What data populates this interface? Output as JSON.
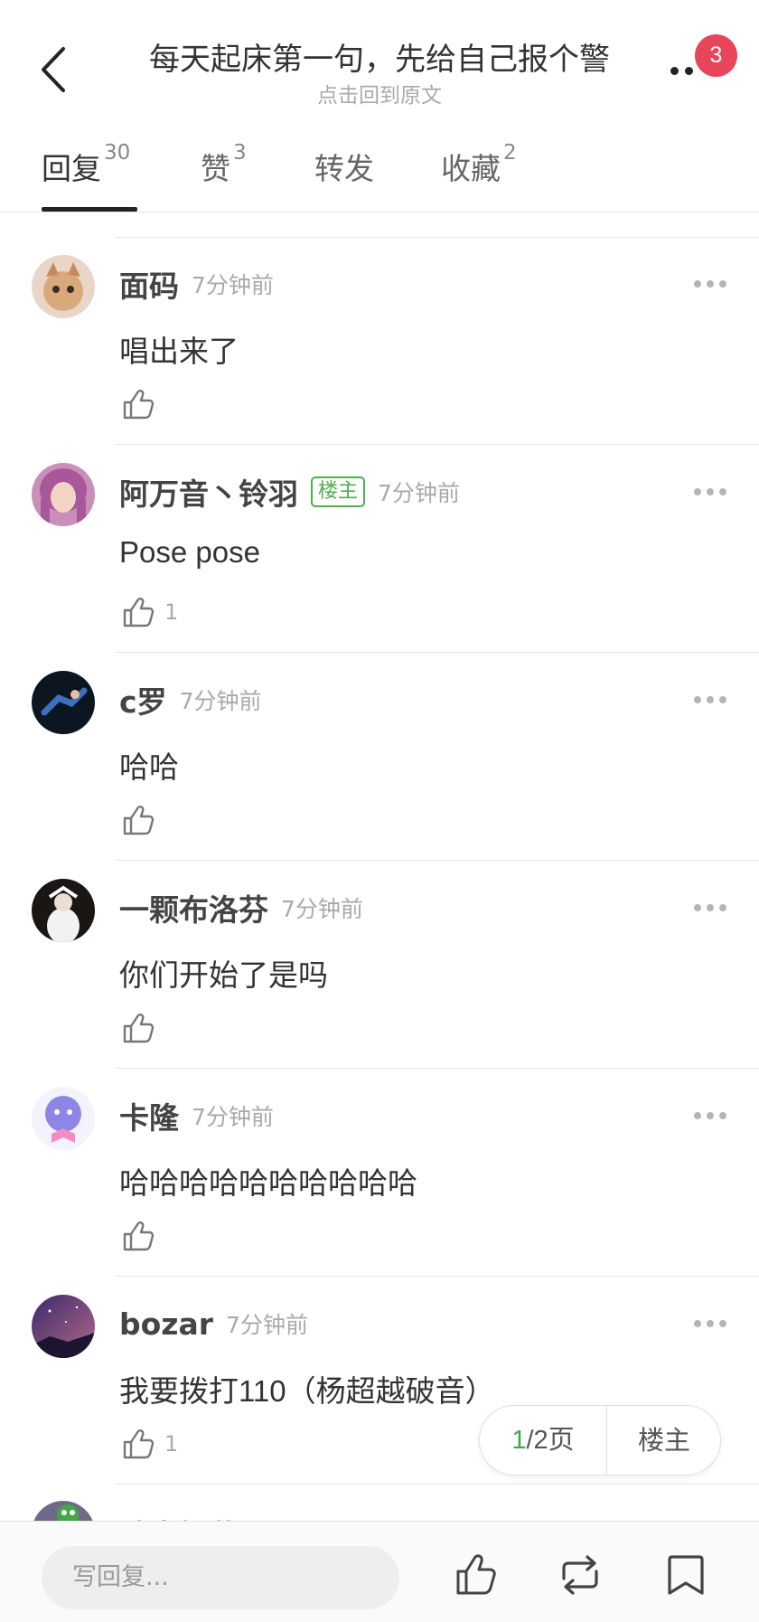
{
  "header": {
    "title": "每天起床第一句，先给自己报个警",
    "subtitle": "点击回到原文",
    "badge_count": "3"
  },
  "tabs": [
    {
      "label": "回复",
      "count": "30",
      "active": true
    },
    {
      "label": "赞",
      "count": "3",
      "active": false
    },
    {
      "label": "转发",
      "count": "",
      "active": false
    },
    {
      "label": "收藏",
      "count": "2",
      "active": false
    }
  ],
  "comments": [
    {
      "user": "面码",
      "time": "7分钟前",
      "text": "唱出来了",
      "likes": "",
      "tag": ""
    },
    {
      "user": "阿万音丶铃羽",
      "tag": "楼主",
      "time": "7分钟前",
      "text": "Pose pose",
      "likes": "1"
    },
    {
      "user": "c罗",
      "time": "7分钟前",
      "text": "哈哈",
      "likes": "",
      "tag": ""
    },
    {
      "user": "一颗布洛芬",
      "time": "7分钟前",
      "text": "你们开始了是吗",
      "likes": "",
      "tag": ""
    },
    {
      "user": "卡隆",
      "time": "7分钟前",
      "text": "哈哈哈哈哈哈哈哈哈哈",
      "likes": "",
      "tag": ""
    },
    {
      "user": "bozar",
      "time": "7分钟前",
      "text": "我要拨打110（杨超越破音）",
      "likes": "1",
      "tag": ""
    }
  ],
  "peek": {
    "user": "晴岚娟花"
  },
  "pager": {
    "current": "1",
    "rest": "/2页",
    "host_button": "楼主"
  },
  "bottombar": {
    "reply_placeholder": "写回复..."
  },
  "colors": {
    "accent_green": "#3da54a",
    "badge_red": "#e9455a"
  },
  "icons": [
    "back-arrow-icon",
    "more-dots-icon",
    "thumbs-up-icon",
    "repost-icon",
    "bookmark-icon"
  ]
}
